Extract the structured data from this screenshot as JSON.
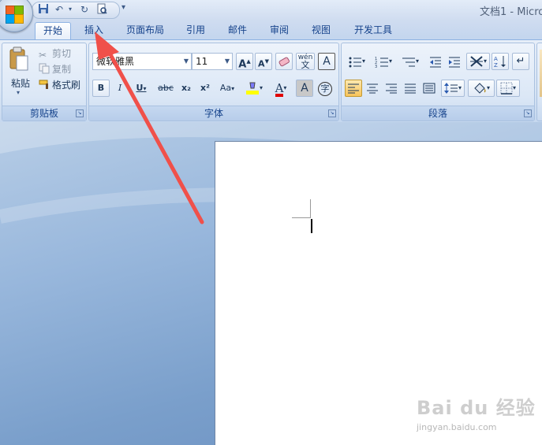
{
  "window": {
    "title": "文档1 - Micro"
  },
  "quick_access": {
    "save": "save-icon",
    "undo": "undo-icon",
    "redo": "redo-icon",
    "print_preview": "print-preview-icon"
  },
  "tabs": [
    "开始",
    "插入",
    "页面布局",
    "引用",
    "邮件",
    "审阅",
    "视图",
    "开发工具"
  ],
  "active_tab": "开始",
  "clipboard": {
    "paste": "粘贴",
    "cut": "剪切",
    "copy": "复制",
    "format_painter": "格式刷",
    "label": "剪贴板"
  },
  "font": {
    "name": "微软雅黑",
    "size": "11",
    "label": "字体",
    "buttons": {
      "bold": "B",
      "italic": "I",
      "underline": "U",
      "strike": "abc",
      "sub": "x₂",
      "sup": "x²",
      "case": "Aa",
      "grow": "A",
      "shrink": "A",
      "clear": "A",
      "phonetic": "wén",
      "char_border": "A",
      "enclose": "字"
    },
    "colors": {
      "highlight": "#ffff00",
      "font_color": "#e00000"
    }
  },
  "paragraph": {
    "label": "段落"
  },
  "watermark": {
    "brand": "Bai du 经验",
    "url": "jingyan.baidu.com"
  },
  "annotation": {
    "arrow_color": "#f0504a"
  }
}
